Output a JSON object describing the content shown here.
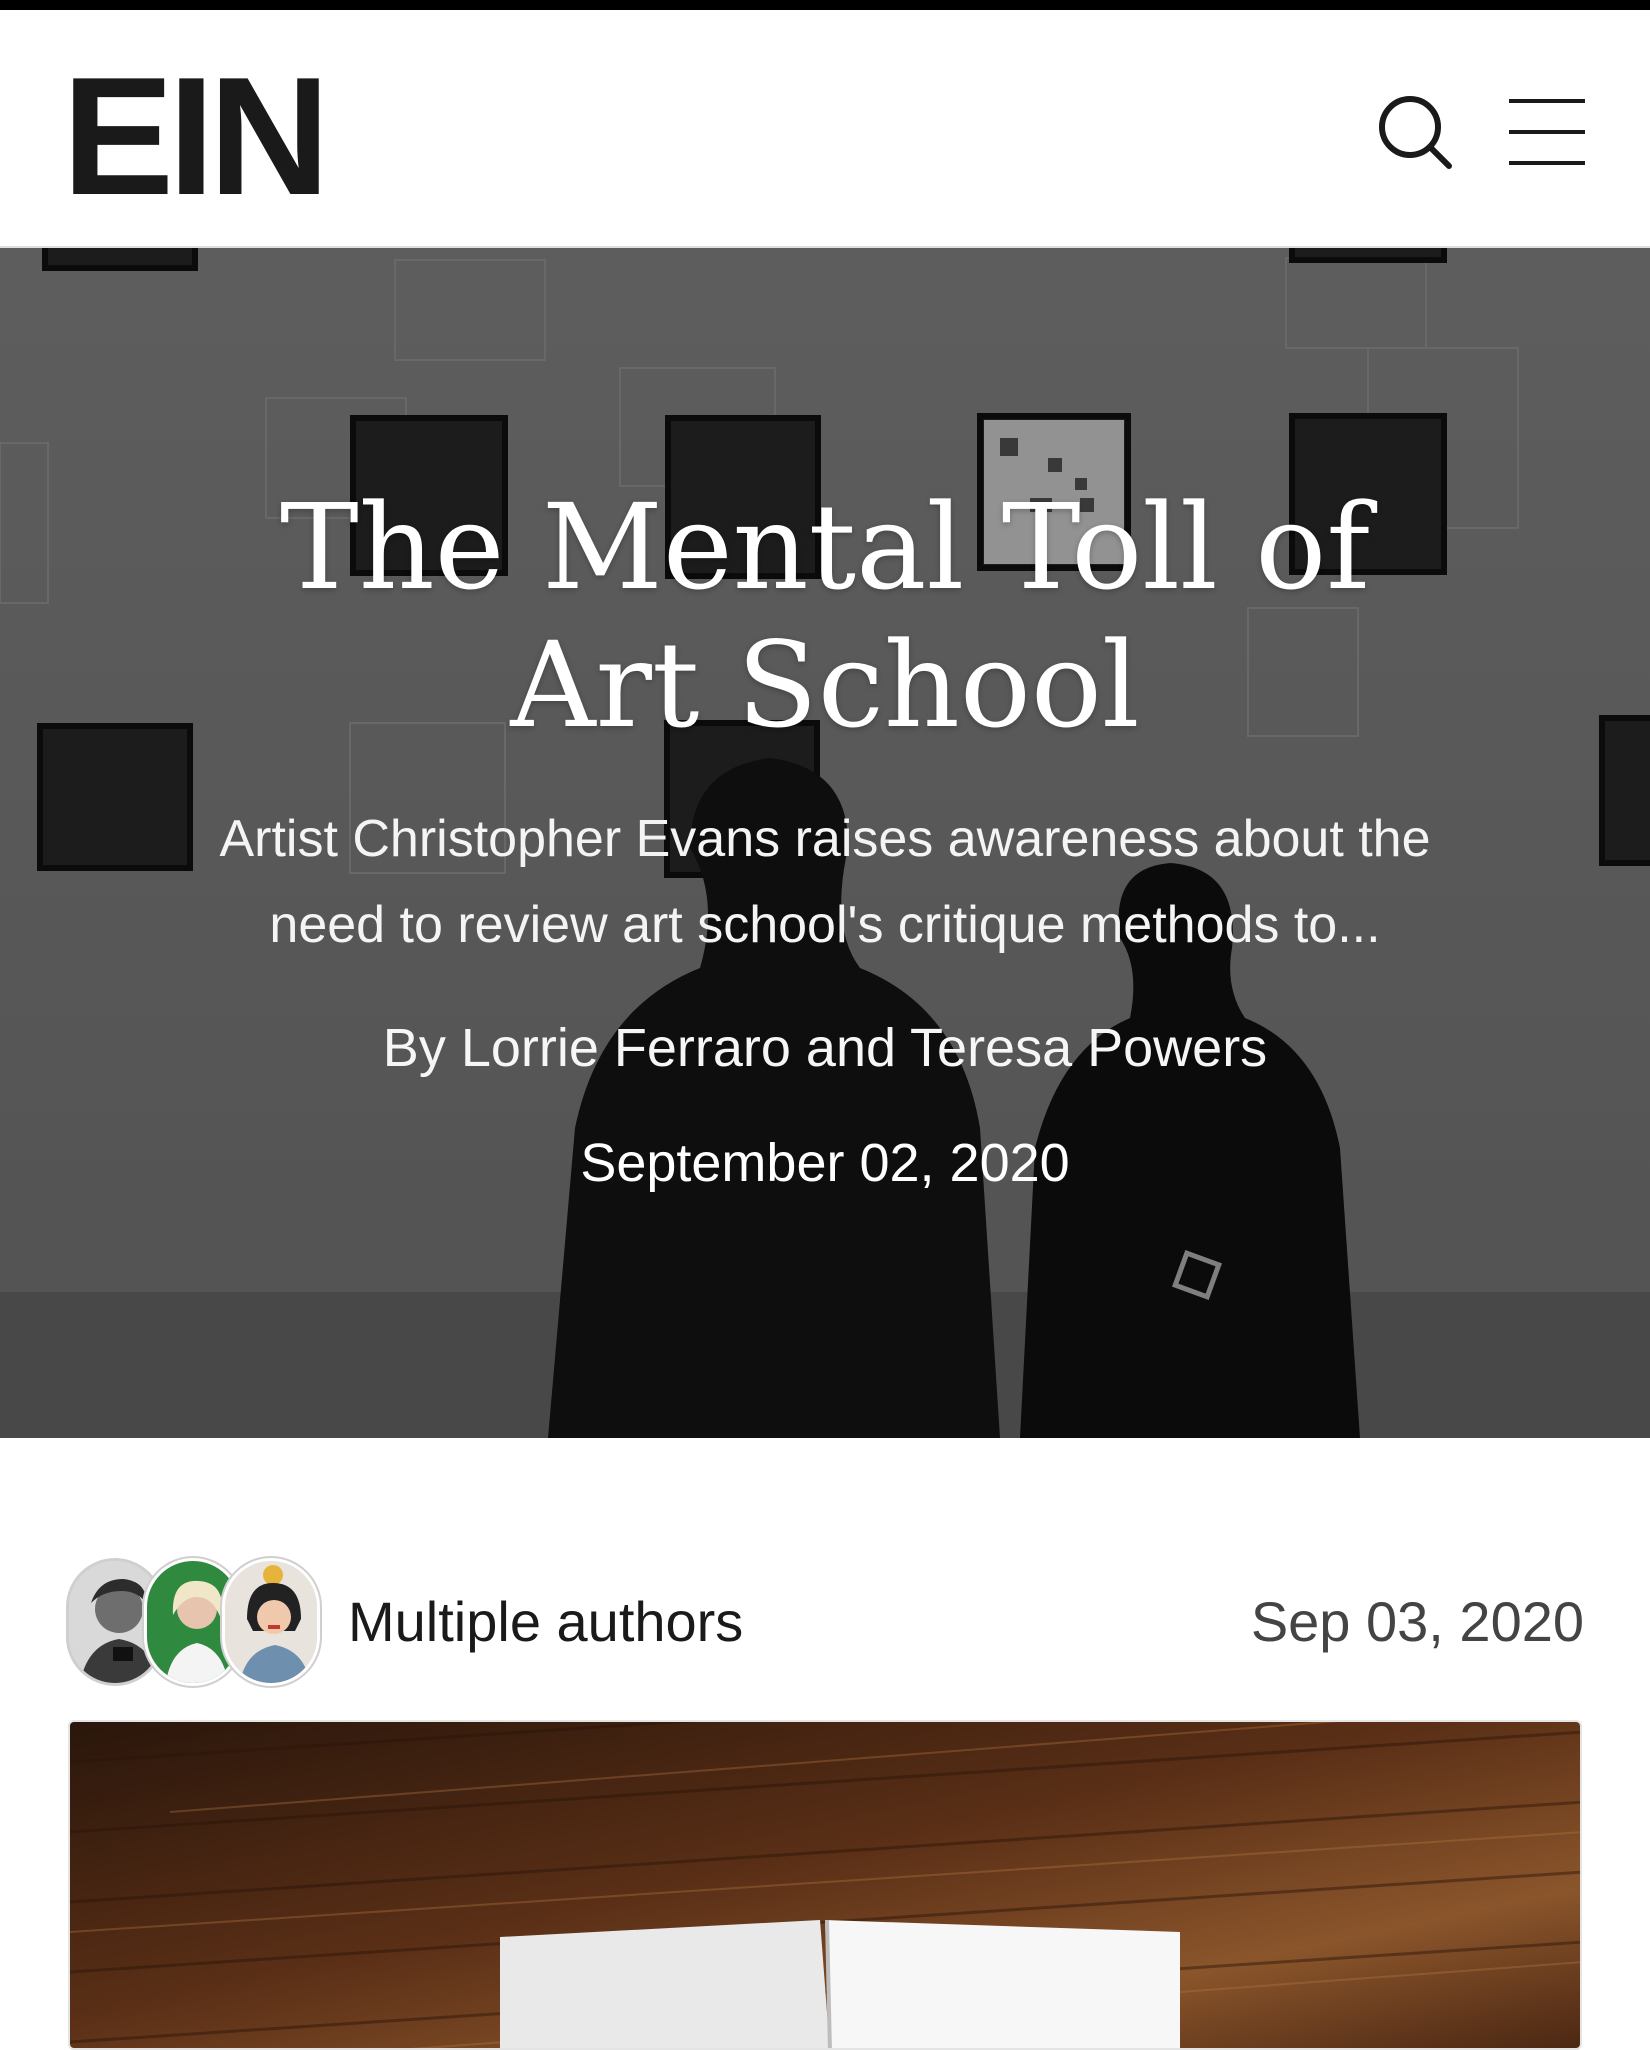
{
  "header": {
    "logo_text": "EIN",
    "search_icon": "search-icon",
    "menu_icon": "hamburger-menu-icon"
  },
  "hero": {
    "title": "The Mental Toll of Art School",
    "summary": "Artist Christopher Evans raises awareness about the need to review art school's critique methods to...",
    "byline": "By Lorrie Ferraro and Teresa Powers",
    "date": "September 02, 2020"
  },
  "post": {
    "authors_label": "Multiple authors",
    "date": "Sep 03, 2020",
    "avatars": [
      {
        "name": "author-avatar-1"
      },
      {
        "name": "author-avatar-2"
      },
      {
        "name": "author-avatar-3"
      }
    ]
  },
  "colors": {
    "text": "#1a1a1a",
    "hero_overlay": "#6f6f6f",
    "white": "#ffffff",
    "avatar_green": "#2f8a3f",
    "wood": "#5a2f16"
  }
}
